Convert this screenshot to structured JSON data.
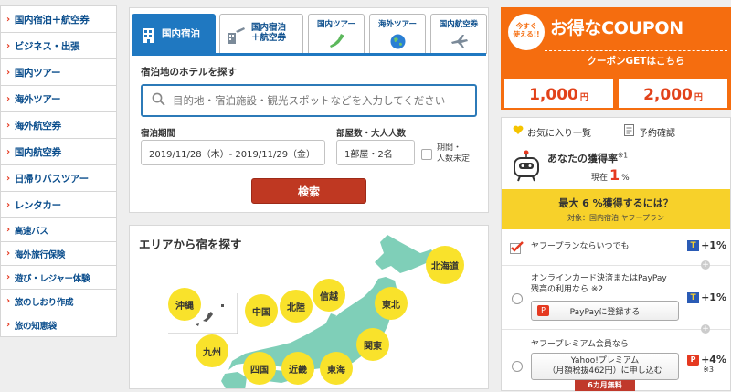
{
  "nav": {
    "items": [
      {
        "label": "国内宿泊＋航空券"
      },
      {
        "label": "ビジネス・出張"
      },
      {
        "label": "国内ツアー"
      },
      {
        "label": "海外ツアー"
      },
      {
        "label": "海外航空券"
      },
      {
        "label": "国内航空券"
      },
      {
        "label": "日帰りバスツアー"
      },
      {
        "label": "レンタカー"
      },
      {
        "label": "高速バス"
      },
      {
        "label": "海外旅行保険"
      },
      {
        "label": "遊び・レジャー体験"
      },
      {
        "label": "旅のしおり作成"
      },
      {
        "label": "旅の知恵袋"
      }
    ],
    "arrow": "›"
  },
  "search": {
    "tabs": [
      {
        "label": "国内宿泊",
        "icon": "hotel-icon"
      },
      {
        "label": "国内宿泊\n＋航空券",
        "icon": "hotel-plane-icon"
      },
      {
        "label": "国内ツアー",
        "icon": "japan-map-icon"
      },
      {
        "label": "海外ツアー",
        "icon": "globe-icon"
      },
      {
        "label": "国内航空券",
        "icon": "airplane-icon"
      }
    ],
    "hotel_label": "宿泊地のホテルを探す",
    "placeholder": "目的地・宿泊施設・観光スポットなどを入力してください",
    "period_label": "宿泊期間",
    "period_value": "2019/11/28（木）- 2019/11/29（金）",
    "rooms_label": "部屋数・大人人数",
    "rooms_value": "1部屋・2名",
    "undecided_label": "期間・\n人数未定",
    "search_button": "検索"
  },
  "map": {
    "title": "エリアから宿を探す",
    "regions": [
      "北海道",
      "東北",
      "関東",
      "信越",
      "北陸",
      "中国",
      "沖縄",
      "九州",
      "四国",
      "近畿",
      "東海"
    ],
    "colors": {
      "land": "#7fcfb8",
      "badge": "#f9e22b"
    }
  },
  "coupon": {
    "badge": "今すぐ\n使える!!",
    "title": "お得なCOUPON",
    "cta": "クーポンGETはこちら",
    "amounts": [
      {
        "value": "1,000",
        "unit": "円"
      },
      {
        "value": "2,000",
        "unit": "円"
      }
    ],
    "color": "#f56d0f"
  },
  "points": {
    "favorites": "お気に入り一覧",
    "reservations": "予約確認",
    "rate_label": "あなたの獲得率",
    "rate_note": "※1",
    "current_label": "現在",
    "current_value": "1",
    "current_unit": "%",
    "max_title": "最大 6 %獲得するには？",
    "target": "対象：国内宿泊 ヤフープラン",
    "rows": [
      {
        "text": "ヤフープランならいつでも",
        "bonus": "+1%",
        "checked": true
      },
      {
        "text": "オンラインカード決済またはPayPay\n残高の利用なら ※2",
        "bonus": "+1%",
        "button": "PayPayに登録する",
        "checked": false
      },
      {
        "text": "ヤフープレミアム会員なら",
        "bonus": "+4%",
        "note": "※3",
        "button": "Yahoo!プレミアム\n（月額税抜462円）に申し込む",
        "ribbon": "6カ月無料",
        "checked": false
      }
    ]
  }
}
